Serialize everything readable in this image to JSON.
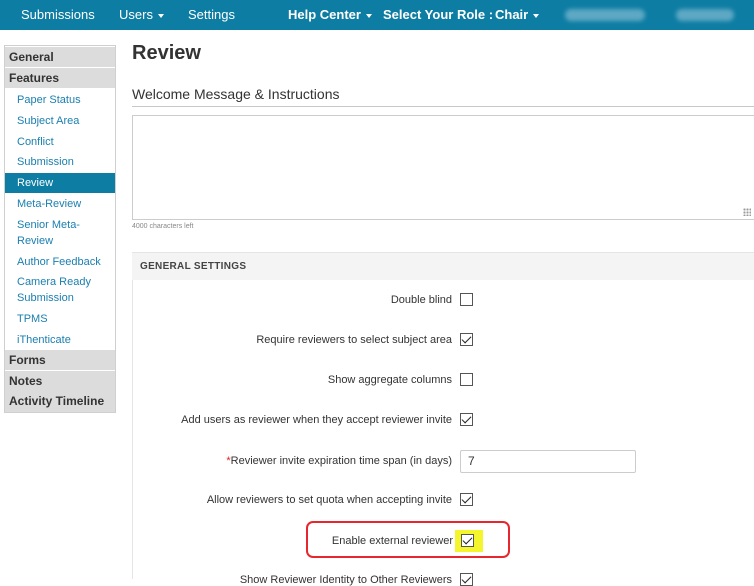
{
  "nav": {
    "submissions": "Submissions",
    "users": "Users",
    "settings": "Settings",
    "help_center": "Help Center",
    "select_role_label": "Select Your Role :",
    "role": "Chair"
  },
  "sidebar": {
    "general": "General",
    "features": "Features",
    "items": [
      "Paper Status",
      "Subject Area",
      "Conflict",
      "Submission",
      "Review",
      "Meta-Review",
      "Senior Meta-",
      "Review",
      "Author Feedback",
      "Camera Ready",
      "Submission",
      "TPMS",
      "iThenticate"
    ],
    "forms": "Forms",
    "notes": "Notes",
    "activity_timeline": "Activity Timeline"
  },
  "main": {
    "title": "Review",
    "welcome_heading": "Welcome Message & Instructions",
    "welcome_text": "",
    "chars_left": "4000 characters left",
    "general_settings_header": "GENERAL SETTINGS",
    "settings": [
      {
        "label": "Double blind",
        "checked": false
      },
      {
        "label": "Require reviewers to select subject area",
        "checked": true
      },
      {
        "label": "Show aggregate columns",
        "checked": false
      },
      {
        "label": "Add users as reviewer when they accept reviewer invite",
        "checked": true
      },
      {
        "label": "Reviewer invite expiration time span (in days)",
        "required_mark": "*",
        "value": "7"
      },
      {
        "label": "Allow reviewers to set quota when accepting invite",
        "checked": true
      },
      {
        "label": "Enable external reviewer",
        "checked": true,
        "highlighted": true
      },
      {
        "label": "Show Reviewer Identity to Other Reviewers",
        "checked": true
      }
    ]
  },
  "colors": {
    "nav_bg": "#0e7da3",
    "active_item_bg": "#0e7da3",
    "link": "#1a7fb0",
    "highlight": "#f5f52e",
    "annotation_red": "#e8262e"
  }
}
